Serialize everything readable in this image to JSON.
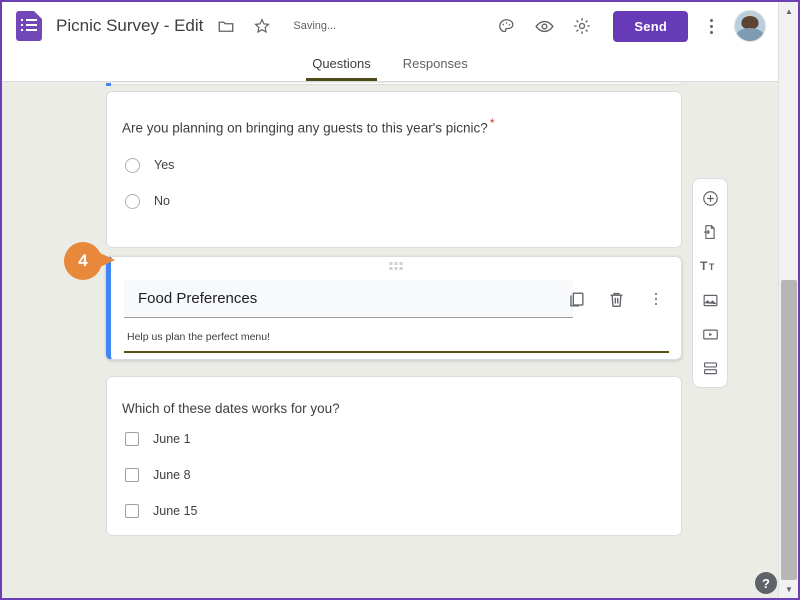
{
  "window": {
    "frame_color": "#6c3fb5"
  },
  "header": {
    "logo_name": "google-forms-logo",
    "doc_title": "Picnic Survey - Edit",
    "folder_icon": "folder-icon",
    "star_icon": "star-icon",
    "save_status": "Saving...",
    "theme_icon": "palette-icon",
    "preview_icon": "eye-preview-icon",
    "settings_icon": "gear-settings-icon",
    "send_label": "Send",
    "send_color": "#673ab7",
    "more_icon": "more-vertical-icon",
    "avatar_name": "user-avatar"
  },
  "tabs": [
    {
      "label": "Questions",
      "active": true
    },
    {
      "label": "Responses",
      "active": false
    }
  ],
  "cards": [
    {
      "type": "radio-question",
      "title": "Are you planning on bringing any guests to this year's picnic?",
      "required_marker": "*",
      "options": [
        "Yes",
        "No"
      ]
    },
    {
      "type": "section-header",
      "selected": true,
      "accent_color": "#4285f4",
      "drag_handle": "drag-handle-dots",
      "section_title": "Food Preferences",
      "section_description": "Help us plan the perfect menu!",
      "description_underline_color": "#575113",
      "actions": {
        "duplicate": "duplicate-icon",
        "delete": "trash-delete-icon",
        "more": "more-options-icon"
      }
    },
    {
      "type": "checkbox-question",
      "title": "Which of these dates works for you?",
      "options": [
        "June 1",
        "June 8",
        "June 15"
      ]
    }
  ],
  "callout": {
    "number": "4",
    "color": "#e8883a"
  },
  "side_toolbar": [
    {
      "icon": "add-question-icon",
      "label": "Add question"
    },
    {
      "icon": "import-questions-icon",
      "label": "Import questions"
    },
    {
      "icon": "add-title-description-icon",
      "label": "Add title and description"
    },
    {
      "icon": "add-image-icon",
      "label": "Add image"
    },
    {
      "icon": "add-video-icon",
      "label": "Add video"
    },
    {
      "icon": "add-section-icon",
      "label": "Add section"
    }
  ],
  "help": {
    "label": "?"
  },
  "scrollbar": {
    "up_arrow": "▲",
    "down_arrow": "▼"
  }
}
